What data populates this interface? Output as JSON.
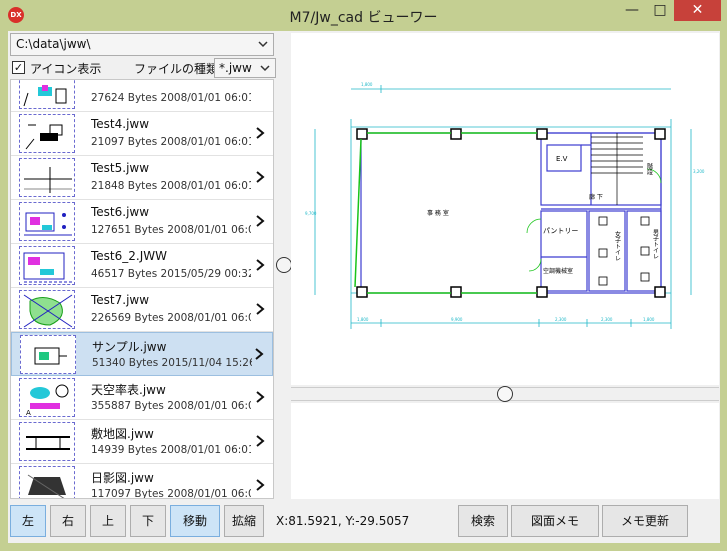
{
  "window": {
    "app_icon_text": "DX",
    "title": "M7/Jw_cad ビューワー",
    "minimize_glyph": "—",
    "maximize_glyph": "□",
    "close_glyph": "✕"
  },
  "left_panel": {
    "path": "C:\\data\\jww\\",
    "icon_display_checked": "✓",
    "icon_display_label": "アイコン表示",
    "file_type_label": "ファイルの種類：",
    "file_type_value": "*.jww",
    "files": [
      {
        "name": "",
        "meta": "27624 Bytes  2008/01/01 06:01:..."
      },
      {
        "name": "Test4.jww",
        "meta": "21097 Bytes  2008/01/01 06:01:..."
      },
      {
        "name": "Test5.jww",
        "meta": "21848 Bytes  2008/01/01 06:01:..."
      },
      {
        "name": "Test6.jww",
        "meta": "127651 Bytes  2008/01/01 06:0..."
      },
      {
        "name": "Test6_2.JWW",
        "meta": "46517 Bytes  2015/05/29 00:32:..."
      },
      {
        "name": "Test7.jww",
        "meta": "226569 Bytes  2008/01/01 06:0..."
      },
      {
        "name": "サンプル.jww",
        "meta": "51340 Bytes  2015/11/04 15:26:..."
      },
      {
        "name": "天空率表.jww",
        "meta": "355887 Bytes  2008/01/01 06:0..."
      },
      {
        "name": "敷地図.jww",
        "meta": "14939 Bytes  2008/01/01 06:01:..."
      },
      {
        "name": "日影図.jww",
        "meta": "117097 Bytes  2008/01/01 06:0..."
      }
    ],
    "selected_index": 6
  },
  "drawing": {
    "room_main": "事  務  室",
    "room_ev": "E.V",
    "room_corridor": "廊  下",
    "room_stair": "階段",
    "room_pantry": "パントリー",
    "room_machine": "空調機械室",
    "room_wc_f": "女子トイレ",
    "room_wc_m": "男子トイレ",
    "dim_top": "1,800",
    "dim_bottom_1": "1,800",
    "dim_bottom_2": "9,900",
    "dim_bottom_3": "2,300",
    "dim_bottom_4": "2,300",
    "dim_bottom_5": "1,800",
    "dim_left": "9,700",
    "dim_right": "3,200"
  },
  "toolbar": {
    "left": "左",
    "right": "右",
    "up": "上",
    "down": "下",
    "move": "移動",
    "zoom": "拡縮",
    "coords": "X:81.5921,  Y:-29.5057",
    "search": "検索",
    "drawing_memo": "図面メモ",
    "memo_update": "メモ更新"
  },
  "colors": {
    "titlebar": "#c4cf92",
    "close": "#c7413a",
    "selection": "#cde0f2",
    "cad_wall": "#3c3cd0",
    "cad_dim": "#1fb8c8",
    "cad_green": "#19c419"
  }
}
